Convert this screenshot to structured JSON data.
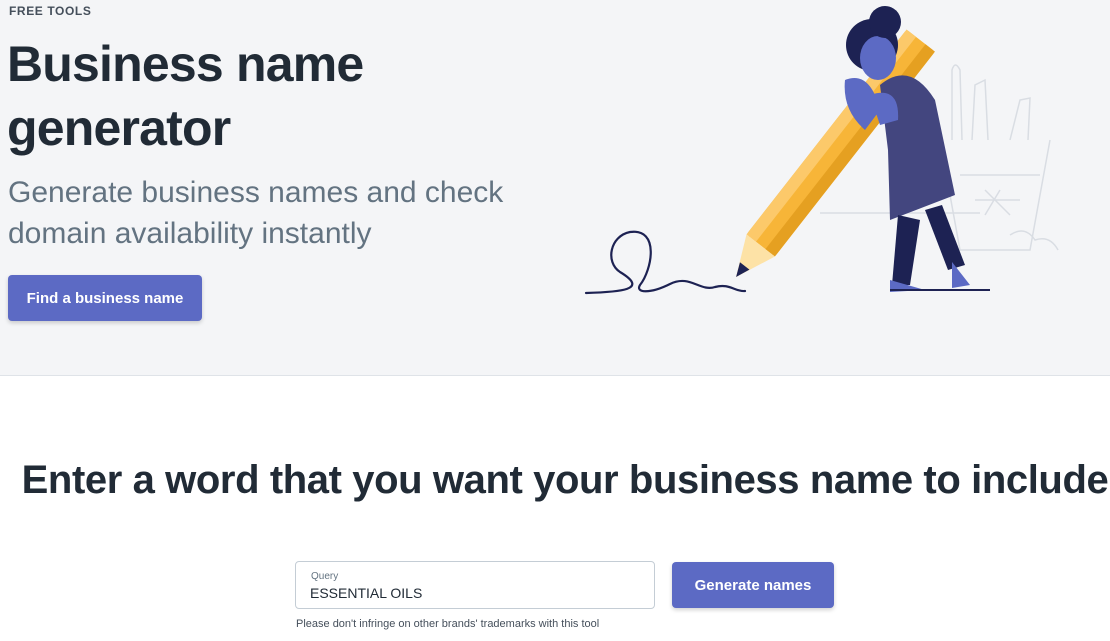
{
  "hero": {
    "eyebrow": "FREE TOOLS",
    "title": "Business name generator",
    "subtitle": "Generate business names and check domain availability instantly",
    "cta_label": "Find a business name"
  },
  "generator": {
    "heading": "Enter a word that you want your business name to include",
    "query_label": "Query",
    "query_value": "ESSENTIAL OILS",
    "submit_label": "Generate names",
    "disclaimer": "Please don't infringe on other brands' trademarks with this tool"
  },
  "colors": {
    "accent": "#5c6ac4",
    "hero_bg": "#f4f5f7",
    "pencil": "#f7b538",
    "figure_dress": "#43467f",
    "figure_skin": "#5c6ac4"
  }
}
